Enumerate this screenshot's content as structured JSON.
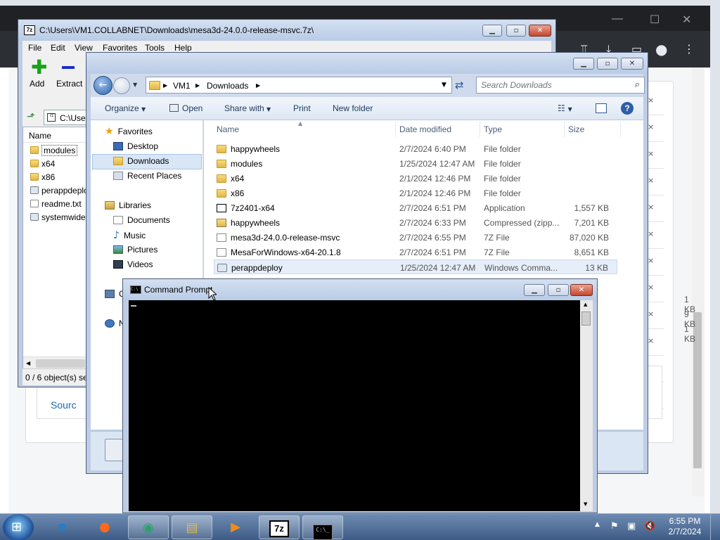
{
  "sevenzip": {
    "title": "C:\\Users\\VM1.COLLABNET\\Downloads\\mesa3d-24.0.0-release-msvc.7z\\",
    "menu": [
      "File",
      "Edit",
      "View",
      "Favorites",
      "Tools",
      "Help"
    ],
    "toolbar": {
      "add": "Add",
      "extract": "Extract"
    },
    "address": "C:\\Use",
    "col_name": "Name",
    "items": [
      "modules",
      "x64",
      "x86",
      "perappdeplo",
      "readme.txt",
      "systemwidec"
    ],
    "status": "0 / 6 object(s) se"
  },
  "explorer": {
    "breadcrumb": [
      "VM1",
      "Downloads"
    ],
    "search_placeholder": "Search Downloads",
    "commands": {
      "organize": "Organize",
      "open": "Open",
      "share": "Share with",
      "print": "Print",
      "new_folder": "New folder"
    },
    "nav": {
      "favorites": "Favorites",
      "desktop": "Desktop",
      "downloads": "Downloads",
      "recent": "Recent Places",
      "libraries": "Libraries",
      "documents": "Documents",
      "music": "Music",
      "pictures": "Pictures",
      "videos": "Videos",
      "computer_abbrev": "C",
      "network_abbrev": "N"
    },
    "columns": {
      "name": "Name",
      "date": "Date modified",
      "type": "Type",
      "size": "Size"
    },
    "files": [
      {
        "name": "happywheels",
        "date": "2/7/2024 6:40 PM",
        "type": "File folder",
        "size": "",
        "icon": "folder-icon"
      },
      {
        "name": "modules",
        "date": "1/25/2024 12:47 AM",
        "type": "File folder",
        "size": "",
        "icon": "folder-icon"
      },
      {
        "name": "x64",
        "date": "2/1/2024 12:46 PM",
        "type": "File folder",
        "size": "",
        "icon": "folder-icon"
      },
      {
        "name": "x86",
        "date": "2/1/2024 12:46 PM",
        "type": "File folder",
        "size": "",
        "icon": "folder-icon"
      },
      {
        "name": "7z2401-x64",
        "date": "2/7/2024 6:51 PM",
        "type": "Application",
        "size": "1,557 KB",
        "icon": "7z-installer-icon"
      },
      {
        "name": "happywheels",
        "date": "2/7/2024 6:33 PM",
        "type": "Compressed (zipp...",
        "size": "7,201 KB",
        "icon": "zip-folder-icon"
      },
      {
        "name": "mesa3d-24.0.0-release-msvc",
        "date": "2/7/2024 6:55 PM",
        "type": "7Z File",
        "size": "87,020 KB",
        "icon": "7z-file-icon"
      },
      {
        "name": "MesaForWindows-x64-20.1.8",
        "date": "2/7/2024 6:51 PM",
        "type": "7Z File",
        "size": "8,651 KB",
        "icon": "7z-file-icon"
      },
      {
        "name": "perappdeploy",
        "date": "1/25/2024 12:47 AM",
        "type": "Windows Comma...",
        "size": "13 KB",
        "icon": "cmd-script-icon"
      }
    ],
    "partial_sizes": [
      "1 KB",
      "9 KB",
      "1 KB"
    ]
  },
  "cmd": {
    "title": "Command Prompt"
  },
  "browser": {
    "source_link": "Sourc"
  },
  "taskbar": {
    "time": "6:55 PM",
    "date": "2/7/2024"
  }
}
